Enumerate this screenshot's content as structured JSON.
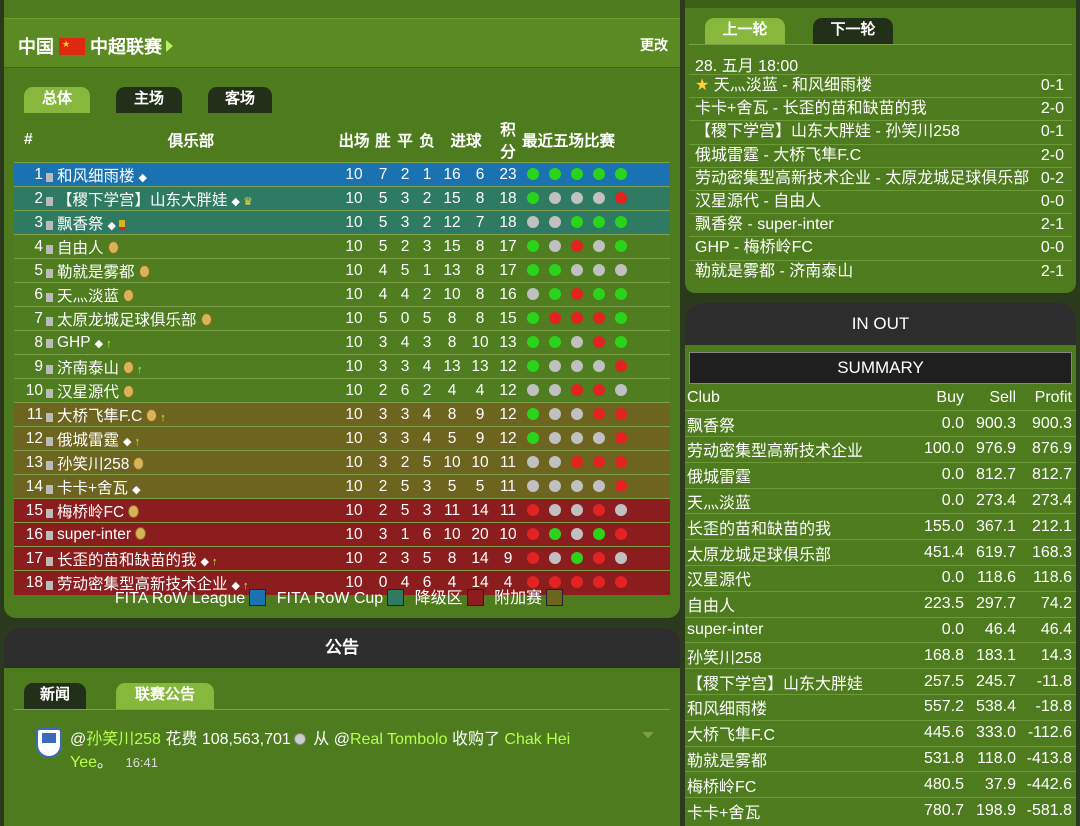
{
  "league": {
    "country": "中国",
    "name": "中超联赛",
    "change_label": "更改",
    "tabs": [
      "总体",
      "主场",
      "客场"
    ],
    "columns": {
      "pos": "#",
      "club": "俱乐部",
      "played": "出场",
      "w": "胜",
      "d": "平",
      "l": "负",
      "goals": "进球",
      "pts": "积分",
      "form": "最近五场比赛"
    },
    "rows": [
      {
        "pos": "1",
        "club": "和风细雨楼",
        "icons": [
          "diamond"
        ],
        "p": "10",
        "w": "7",
        "d": "2",
        "l": "1",
        "gf": "16",
        "ga": "6",
        "pts": "23",
        "form": [
          "w",
          "w",
          "w",
          "w",
          "w"
        ],
        "zone": "blue"
      },
      {
        "pos": "2",
        "club": "【稷下学宫】山东大胖娃",
        "icons": [
          "diamond",
          "trophy"
        ],
        "p": "10",
        "w": "5",
        "d": "3",
        "l": "2",
        "gf": "15",
        "ga": "8",
        "pts": "18",
        "form": [
          "w",
          "d",
          "d",
          "d",
          "l"
        ],
        "zone": "teal"
      },
      {
        "pos": "3",
        "club": "飘香祭",
        "icons": [
          "diamond",
          "card"
        ],
        "p": "10",
        "w": "5",
        "d": "3",
        "l": "2",
        "gf": "12",
        "ga": "7",
        "pts": "18",
        "form": [
          "d",
          "d",
          "w",
          "w",
          "w"
        ],
        "zone": "teal"
      },
      {
        "pos": "4",
        "club": "自由人",
        "icons": [
          "coin"
        ],
        "p": "10",
        "w": "5",
        "d": "2",
        "l": "3",
        "gf": "15",
        "ga": "8",
        "pts": "17",
        "form": [
          "w",
          "d",
          "l",
          "d",
          "w"
        ],
        "zone": "green"
      },
      {
        "pos": "5",
        "club": "勒就是雾都",
        "icons": [
          "coin"
        ],
        "p": "10",
        "w": "4",
        "d": "5",
        "l": "1",
        "gf": "13",
        "ga": "8",
        "pts": "17",
        "form": [
          "w",
          "w",
          "d",
          "d",
          "d"
        ],
        "zone": "green"
      },
      {
        "pos": "6",
        "club": "天灬淡蓝",
        "icons": [
          "coin"
        ],
        "p": "10",
        "w": "4",
        "d": "4",
        "l": "2",
        "gf": "10",
        "ga": "8",
        "pts": "16",
        "form": [
          "d",
          "w",
          "l",
          "w",
          "w"
        ],
        "zone": "green"
      },
      {
        "pos": "7",
        "club": "太原龙城足球俱乐部",
        "icons": [
          "coin"
        ],
        "p": "10",
        "w": "5",
        "d": "0",
        "l": "5",
        "gf": "8",
        "ga": "8",
        "pts": "15",
        "form": [
          "w",
          "l",
          "l",
          "l",
          "w"
        ],
        "zone": "green"
      },
      {
        "pos": "8",
        "club": "GHP",
        "icons": [
          "diamond",
          "up"
        ],
        "p": "10",
        "w": "3",
        "d": "4",
        "l": "3",
        "gf": "8",
        "ga": "10",
        "pts": "13",
        "form": [
          "w",
          "w",
          "d",
          "l",
          "w"
        ],
        "zone": "green"
      },
      {
        "pos": "9",
        "club": "济南泰山",
        "icons": [
          "coin",
          "up"
        ],
        "p": "10",
        "w": "3",
        "d": "3",
        "l": "4",
        "gf": "13",
        "ga": "13",
        "pts": "12",
        "form": [
          "w",
          "d",
          "d",
          "d",
          "l"
        ],
        "zone": "green"
      },
      {
        "pos": "10",
        "club": "汉星源代",
        "icons": [
          "coin"
        ],
        "p": "10",
        "w": "2",
        "d": "6",
        "l": "2",
        "gf": "4",
        "ga": "4",
        "pts": "12",
        "form": [
          "d",
          "d",
          "l",
          "l",
          "d"
        ],
        "zone": "green"
      },
      {
        "pos": "11",
        "club": "大桥飞隼F.C",
        "icons": [
          "coin",
          "up"
        ],
        "p": "10",
        "w": "3",
        "d": "3",
        "l": "4",
        "gf": "8",
        "ga": "9",
        "pts": "12",
        "form": [
          "w",
          "d",
          "d",
          "l",
          "l"
        ],
        "zone": "olive"
      },
      {
        "pos": "12",
        "club": "俄城雷霆",
        "icons": [
          "diamond",
          "up"
        ],
        "p": "10",
        "w": "3",
        "d": "3",
        "l": "4",
        "gf": "5",
        "ga": "9",
        "pts": "12",
        "form": [
          "w",
          "d",
          "d",
          "d",
          "l"
        ],
        "zone": "olive"
      },
      {
        "pos": "13",
        "club": "孙笑川258",
        "icons": [
          "coin"
        ],
        "p": "10",
        "w": "3",
        "d": "2",
        "l": "5",
        "gf": "10",
        "ga": "10",
        "pts": "11",
        "form": [
          "d",
          "d",
          "l",
          "l",
          "l"
        ],
        "zone": "olive"
      },
      {
        "pos": "14",
        "club": "卡卡+舍瓦",
        "icons": [
          "diamond"
        ],
        "p": "10",
        "w": "2",
        "d": "5",
        "l": "3",
        "gf": "5",
        "ga": "5",
        "pts": "11",
        "form": [
          "d",
          "d",
          "d",
          "d",
          "l"
        ],
        "zone": "olive"
      },
      {
        "pos": "15",
        "club": "梅桥岭FC",
        "icons": [
          "coin"
        ],
        "p": "10",
        "w": "2",
        "d": "5",
        "l": "3",
        "gf": "11",
        "ga": "14",
        "pts": "11",
        "form": [
          "l",
          "d",
          "d",
          "l",
          "d"
        ],
        "zone": "red"
      },
      {
        "pos": "16",
        "club": "super-inter",
        "icons": [
          "coin"
        ],
        "p": "10",
        "w": "3",
        "d": "1",
        "l": "6",
        "gf": "10",
        "ga": "20",
        "pts": "10",
        "form": [
          "l",
          "w",
          "d",
          "w",
          "l"
        ],
        "zone": "red"
      },
      {
        "pos": "17",
        "club": "长歪的苗和缺苗的我",
        "icons": [
          "diamond",
          "up"
        ],
        "p": "10",
        "w": "2",
        "d": "3",
        "l": "5",
        "gf": "8",
        "ga": "14",
        "pts": "9",
        "form": [
          "l",
          "d",
          "w",
          "l",
          "d"
        ],
        "zone": "red"
      },
      {
        "pos": "18",
        "club": "劳动密集型高新技术企业",
        "icons": [
          "diamond",
          "up"
        ],
        "p": "10",
        "w": "0",
        "d": "4",
        "l": "6",
        "gf": "4",
        "ga": "14",
        "pts": "4",
        "form": [
          "l",
          "l",
          "l",
          "l",
          "l"
        ],
        "zone": "red"
      }
    ],
    "legend": [
      {
        "label": "FITA RoW League",
        "color": "#1b72b0"
      },
      {
        "label": "FITA RoW Cup",
        "color": "#2f7a62"
      },
      {
        "label": "降级区",
        "color": "#8b1d1e"
      },
      {
        "label": "附加赛",
        "color": "#6c641f"
      }
    ]
  },
  "news": {
    "header": "公告",
    "tabs": [
      "新闻",
      "联赛公告"
    ],
    "message": {
      "at1": "@",
      "user": "孙笑川258",
      "t1": " 花费 108,563,701",
      "t2": " 从 @",
      "from": "Real Tombolo",
      "t3": " 收购了 ",
      "player": "Chak Hei Yee",
      "t4": "。",
      "time": "16:41"
    }
  },
  "round": {
    "prev_label": "上一轮",
    "next_label": "下一轮",
    "date": "28. 五月 18:00",
    "matches": [
      {
        "text": "天灬淡蓝 - 和风细雨楼",
        "score": "0-1",
        "star": true
      },
      {
        "text": "卡卡+舍瓦 - 长歪的苗和缺苗的我",
        "score": "2-0"
      },
      {
        "text": "【稷下学宫】山东大胖娃 - 孙笑川258",
        "score": "0-1"
      },
      {
        "text": "俄城雷霆 - 大桥飞隼F.C",
        "score": "2-0"
      },
      {
        "text": "劳动密集型高新技术企业 - 太原龙城足球俱乐部",
        "score": "0-2"
      },
      {
        "text": "汉星源代 - 自由人",
        "score": "0-0"
      },
      {
        "text": "飘香祭 - super-inter",
        "score": "2-1"
      },
      {
        "text": "GHP - 梅桥岭FC",
        "score": "0-0"
      },
      {
        "text": "勒就是雾都 - 济南泰山",
        "score": "2-1"
      }
    ]
  },
  "inout": {
    "header": "IN OUT",
    "summary": "SUMMARY",
    "columns": {
      "club": "Club",
      "buy": "Buy",
      "sell": "Sell",
      "profit": "Profit"
    },
    "rows": [
      {
        "club": "飘香祭",
        "buy": "0.0",
        "sell": "900.3",
        "profit": "900.3"
      },
      {
        "club": "劳动密集型高新技术企业",
        "buy": "100.0",
        "sell": "976.9",
        "profit": "876.9"
      },
      {
        "club": "俄城雷霆",
        "buy": "0.0",
        "sell": "812.7",
        "profit": "812.7"
      },
      {
        "club": "天灬淡蓝",
        "buy": "0.0",
        "sell": "273.4",
        "profit": "273.4"
      },
      {
        "club": "长歪的苗和缺苗的我",
        "buy": "155.0",
        "sell": "367.1",
        "profit": "212.1"
      },
      {
        "club": "太原龙城足球俱乐部",
        "buy": "451.4",
        "sell": "619.7",
        "profit": "168.3"
      },
      {
        "club": "汉星源代",
        "buy": "0.0",
        "sell": "118.6",
        "profit": "118.6"
      },
      {
        "club": "自由人",
        "buy": "223.5",
        "sell": "297.7",
        "profit": "74.2"
      },
      {
        "club": "super-inter",
        "buy": "0.0",
        "sell": "46.4",
        "profit": "46.4"
      },
      {
        "club": "孙笑川258",
        "buy": "168.8",
        "sell": "183.1",
        "profit": "14.3"
      },
      {
        "club": "【稷下学宫】山东大胖娃",
        "buy": "257.5",
        "sell": "245.7",
        "profit": "-11.8"
      },
      {
        "club": "和风细雨楼",
        "buy": "557.2",
        "sell": "538.4",
        "profit": "-18.8"
      },
      {
        "club": "大桥飞隼F.C",
        "buy": "445.6",
        "sell": "333.0",
        "profit": "-112.6"
      },
      {
        "club": "勒就是雾都",
        "buy": "531.8",
        "sell": "118.0",
        "profit": "-413.8"
      },
      {
        "club": "梅桥岭FC",
        "buy": "480.5",
        "sell": "37.9",
        "profit": "-442.6"
      },
      {
        "club": "卡卡+舍瓦",
        "buy": "780.7",
        "sell": "198.9",
        "profit": "-581.8"
      }
    ]
  }
}
